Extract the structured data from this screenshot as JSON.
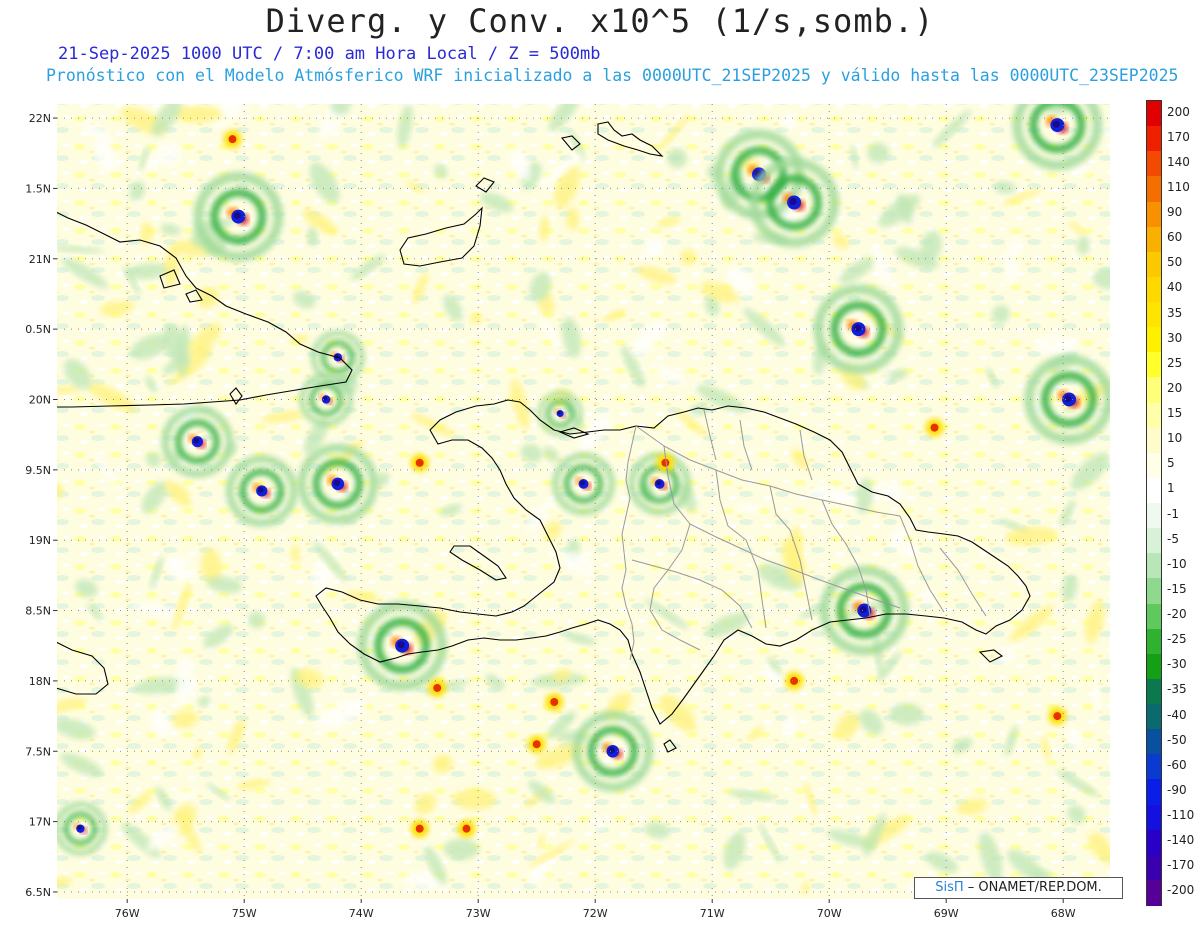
{
  "header": {
    "title": "Diverg. y Conv. x10^5 (1/s,somb.)",
    "line1": "21-Sep-2025  1000 UTC / 7:00 am Hora Local / Z = 500mb",
    "line2": "Pronóstico con el Modelo Atmósferico WRF inicializado a las 0000UTC_21SEP2025 y válido hasta las  0000UTC_23SEP2025"
  },
  "axes": {
    "lat_labels": [
      "22N",
      "1.5N",
      "21N",
      "0.5N",
      "20N",
      "9.5N",
      "19N",
      "8.5N",
      "18N",
      "7.5N",
      "17N",
      "6.5N"
    ],
    "lat_values": [
      22,
      21.5,
      21,
      20.5,
      20,
      19.5,
      19,
      18.5,
      18,
      17.5,
      17,
      16.5
    ],
    "lon_labels": [
      "76W",
      "75W",
      "74W",
      "73W",
      "72W",
      "71W",
      "70W",
      "69W",
      "68W"
    ],
    "lon_values": [
      -76,
      -75,
      -74,
      -73,
      -72,
      -71,
      -70,
      -69,
      -68
    ],
    "lat_range": [
      16.45,
      22.1
    ],
    "lon_range": [
      -76.6,
      -67.6
    ]
  },
  "colorbar": {
    "labels": [
      "200",
      "170",
      "140",
      "110",
      "90",
      "60",
      "50",
      "40",
      "35",
      "30",
      "25",
      "20",
      "15",
      "10",
      "5",
      "1",
      "-1",
      "-5",
      "-10",
      "-15",
      "-20",
      "-25",
      "-30",
      "-35",
      "-40",
      "-50",
      "-60",
      "-90",
      "-110",
      "-140",
      "-170",
      "-200"
    ],
    "colors": [
      "#e00000",
      "#ee2000",
      "#f24a00",
      "#f46e00",
      "#f89000",
      "#fab000",
      "#fcc800",
      "#ffd800",
      "#ffe400",
      "#fff000",
      "#ffff2a",
      "#ffff7a",
      "#ffffaa",
      "#fffccc",
      "#fffee6",
      "#ffffff",
      "#f0f9f0",
      "#d8f2d8",
      "#b8e6b8",
      "#8fd98f",
      "#5fc85f",
      "#2fb22f",
      "#14a014",
      "#0a7a4e",
      "#0a6a6e",
      "#0a50a0",
      "#0a3ad0",
      "#0a1ee8",
      "#1410e0",
      "#2800c8",
      "#3a00b0",
      "#560098"
    ]
  },
  "credit": {
    "logo": "SisΠ",
    "text": "– ONAMET/REP.DOM."
  },
  "features": {
    "colors": {
      "coast": "#000000",
      "provinces": "#999999",
      "grid": "#888888"
    },
    "convergence_centers": [
      {
        "lon": -75.05,
        "lat": 21.3,
        "strength": 1.0
      },
      {
        "lon": -70.6,
        "lat": 21.6,
        "strength": 1.0
      },
      {
        "lon": -70.3,
        "lat": 21.4,
        "strength": 1.0
      },
      {
        "lon": -69.75,
        "lat": 20.5,
        "strength": 1.0
      },
      {
        "lon": -67.95,
        "lat": 20.0,
        "strength": 1.0
      },
      {
        "lon": -73.65,
        "lat": 18.25,
        "strength": 1.0
      },
      {
        "lon": -71.85,
        "lat": 17.5,
        "strength": 0.9
      },
      {
        "lon": -69.7,
        "lat": 18.5,
        "strength": 1.0
      },
      {
        "lon": -68.05,
        "lat": 21.95,
        "strength": 1.0
      },
      {
        "lon": -75.4,
        "lat": 19.7,
        "strength": 0.8
      },
      {
        "lon": -74.85,
        "lat": 19.35,
        "strength": 0.8
      },
      {
        "lon": -74.2,
        "lat": 19.4,
        "strength": 0.9
      },
      {
        "lon": -72.1,
        "lat": 19.4,
        "strength": 0.7
      },
      {
        "lon": -71.45,
        "lat": 19.4,
        "strength": 0.7
      },
      {
        "lon": -74.2,
        "lat": 20.3,
        "strength": 0.6
      },
      {
        "lon": -74.3,
        "lat": 20.0,
        "strength": 0.6
      },
      {
        "lon": -72.3,
        "lat": 19.9,
        "strength": 0.5
      },
      {
        "lon": -76.4,
        "lat": 16.95,
        "strength": 0.6
      }
    ],
    "divergence_spots": [
      {
        "lon": -75.1,
        "lat": 21.85
      },
      {
        "lon": -73.5,
        "lat": 19.55
      },
      {
        "lon": -73.35,
        "lat": 17.95
      },
      {
        "lon": -72.35,
        "lat": 17.85
      },
      {
        "lon": -73.1,
        "lat": 16.95
      },
      {
        "lon": -72.5,
        "lat": 17.55
      },
      {
        "lon": -70.3,
        "lat": 18.0
      },
      {
        "lon": -68.05,
        "lat": 17.75
      },
      {
        "lon": -69.1,
        "lat": 19.8
      },
      {
        "lon": -71.4,
        "lat": 19.55
      },
      {
        "lon": -73.5,
        "lat": 16.95
      }
    ]
  }
}
